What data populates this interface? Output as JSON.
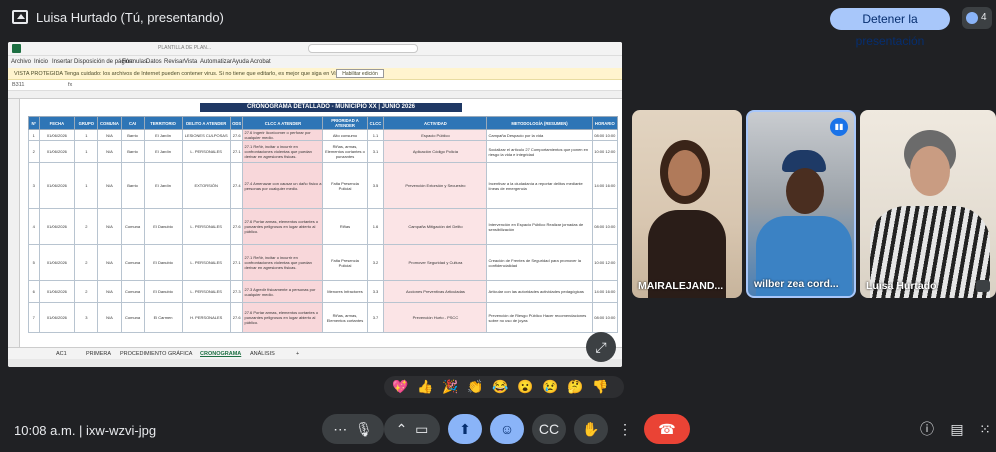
{
  "topbar": {
    "presenter": "Luisa Hurtado (Tú, presentando)",
    "stop_button": "Detener la presentación",
    "participants_count": "4"
  },
  "spreadsheet": {
    "window_title": "PLANTILLA DE PLAN...",
    "menu": [
      "Archivo",
      "Inicio",
      "Insertar",
      "Disposición de página",
      "Fórmulas",
      "Datos",
      "Revisar",
      "Vista",
      "Automatizar",
      "Ayuda",
      "Acrobat"
    ],
    "warning": "VISTA PROTEGIDA  Tenga cuidado: los archivos de Internet pueden contener virus. Si no tiene que editarlo, es mejor que siga en Vista protegida.",
    "warning_button": "Habilitar edición",
    "cell_ref": "B311",
    "sheet_title": "CRONOGRAMA DETALLADO - MUNICIPIO XX | JUNIO 2026",
    "columns": [
      "Nº",
      "FECHA",
      "GRUPO",
      "COMUNA",
      "CAI",
      "TERRITORIO",
      "DELITO A ATENDER",
      "ODS",
      "CLCC A ATENDER",
      "PRIORIDAD A ATENDER",
      "CLCC",
      "ACTIVIDAD",
      "METODOLOGÍA (RESUMEN)",
      "HORARIO"
    ],
    "rows": [
      [
        "1",
        "01/06/2026",
        "1",
        "N/A",
        "Barrio",
        "El Jardín",
        "LESIONES CULPOSAS",
        "27.6",
        "27.6 Ingerir licor/comer o perforar por cualquier medio.",
        "Alto consumo",
        "1.1",
        "Espacio Público",
        "Campaña Despacio por la vida",
        "08:00 10:00"
      ],
      [
        "2",
        "01/06/2026",
        "1",
        "N/A",
        "Barrio",
        "El Jardín",
        "L. PERSONALES",
        "27.1",
        "27.1 Reñir, incitar o incurrir en confrontaciones violentas que puedan derivar en agresiones físicas.",
        "Riñas, armas, Elementos cortantes o punzantes",
        "3.1",
        "Aplicación Código Policía",
        "Socializar el artículo 27 Comportamientos que ponen en riesgo la vida e integridad",
        "10:00 12:00"
      ],
      [
        "3",
        "01/06/2026",
        "1",
        "N/A",
        "Barrio",
        "El Jardín",
        "EXTORSIÓN",
        "27.4",
        "27.4 Amenazar con causar un daño físico a personas por cualquier medio.",
        "Falta Presencia Policial",
        "3.5",
        "Prevención Extorsión y Secuestro",
        "Incentivar a la ciudadanía a reportar delitos mediante líneas de emergencia",
        "14:00 16:00"
      ],
      [
        "4",
        "01/06/2026",
        "2",
        "N/A",
        "Comuna",
        "El Danubio",
        "L. PERSONALES",
        "27.6",
        "27.6 Portar armas, elementos cortantes o punzantes peligrosos en lugar abierto al público.",
        "Riñas",
        "1.6",
        "Campaña Mitigación del Delito",
        "Intervención en Espacio Público Realizar jornadas de sensibilización",
        "08:00 10:00"
      ],
      [
        "5",
        "01/06/2026",
        "2",
        "N/A",
        "Comuna",
        "El Danubio",
        "L. PERSONALES",
        "27.1",
        "27.1 Reñir, incitar o incurrir en confrontaciones violentas que puedan derivar en agresiones físicas.",
        "Falta Presencia Policial",
        "3.2",
        "Promover Seguridad y Cultura",
        "Creación de Frentes de Seguridad para promover la confidencialidad",
        "10:00 12:00"
      ],
      [
        "6",
        "01/06/2026",
        "2",
        "N/A",
        "Comuna",
        "El Danubio",
        "L. PERSONALES",
        "27.3",
        "27.3 Agredir físicamente a personas por cualquier medio.",
        "Menores Infractores",
        "3.3",
        "Acciones Preventivas Articuladas",
        "Articular con las autoridades actividades pedagógicas",
        "14:00 16:00"
      ],
      [
        "7",
        "01/06/2026",
        "3",
        "N/A",
        "Comuna",
        "El Carmen",
        "H. PERSONALES",
        "27.6",
        "27.6 Portar armas, elementos cortantes o punzantes peligrosos en lugar abierto al público.",
        "Riñas, armas, Elementos cortantes",
        "3.7",
        "Prevención Hurto - PSCC",
        "Prevención de Riesgo Público Hacer recomendaciones sobre no uso de joyas",
        "08:00 10:00"
      ]
    ],
    "sheet_tabs": [
      "AC1",
      "PRIMERA",
      "PROCEDIMIENTO",
      "GRÁFICA",
      "CRONOGRAMA",
      "ANÁLISIS",
      "+"
    ],
    "active_tab": "CRONOGRAMA"
  },
  "participants": [
    {
      "name": "MAIRALEJAND..."
    },
    {
      "name": "wilber zea cord..."
    },
    {
      "name": "Luisa Hurtado"
    }
  ],
  "reactions": [
    "💖",
    "👍",
    "🎉",
    "👏",
    "😂",
    "😮",
    "😢",
    "🤔",
    "👎"
  ],
  "bottombar": {
    "time_code": "10:08 a.m.  |  ixw-wzvi-jpg"
  },
  "colors": {
    "accent": "#8ab4f8",
    "end_call": "#ea4335",
    "background": "#202124",
    "header_blue": "#2e75b6"
  }
}
